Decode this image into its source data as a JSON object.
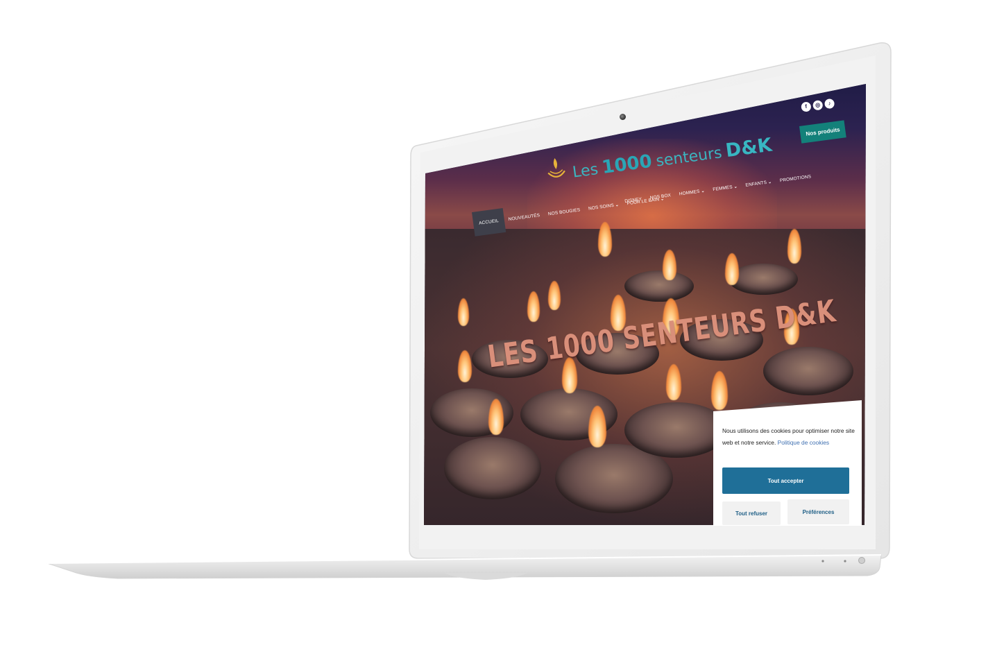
{
  "site": {
    "logo": {
      "word1": "Les",
      "word2": "1000",
      "word3": "senteurs",
      "word4": "D&K"
    },
    "socials": [
      {
        "icon": "facebook-icon",
        "glyph": "f"
      },
      {
        "icon": "instagram-icon",
        "glyph": "◎"
      },
      {
        "icon": "tiktok-icon",
        "glyph": "♪"
      }
    ],
    "products_button": "Nos produits",
    "nav_row_1": [
      {
        "label": "Disney",
        "dropdown": false
      },
      {
        "label": "Nos Box",
        "dropdown": false
      },
      {
        "label": "Hommes",
        "dropdown": true
      },
      {
        "label": "Femmes",
        "dropdown": true
      },
      {
        "label": "Enfants",
        "dropdown": true
      },
      {
        "label": "Promotions",
        "dropdown": false
      }
    ],
    "nav_row_2": [
      {
        "label": "Accueil",
        "dropdown": false,
        "active": true
      },
      {
        "label": "Nouveautés",
        "dropdown": false
      },
      {
        "label": "Nos bougies",
        "dropdown": false
      },
      {
        "label": "Nos soins",
        "dropdown": true
      },
      {
        "label": "Pour le bain",
        "dropdown": true
      }
    ],
    "hero_title": "LES 1000 SENTEURS D&K",
    "colors": {
      "accent_teal": "#13817a",
      "logo_teal": "#2aa6b6",
      "accept_blue": "#1f6f98"
    }
  },
  "cookie": {
    "message": "Nous utilisons des cookies pour optimiser notre site web et notre service.",
    "policy_link": "Politique de cookies",
    "accept": "Tout accepter",
    "refuse": "Tout refuser",
    "preferences": "Préférences"
  }
}
